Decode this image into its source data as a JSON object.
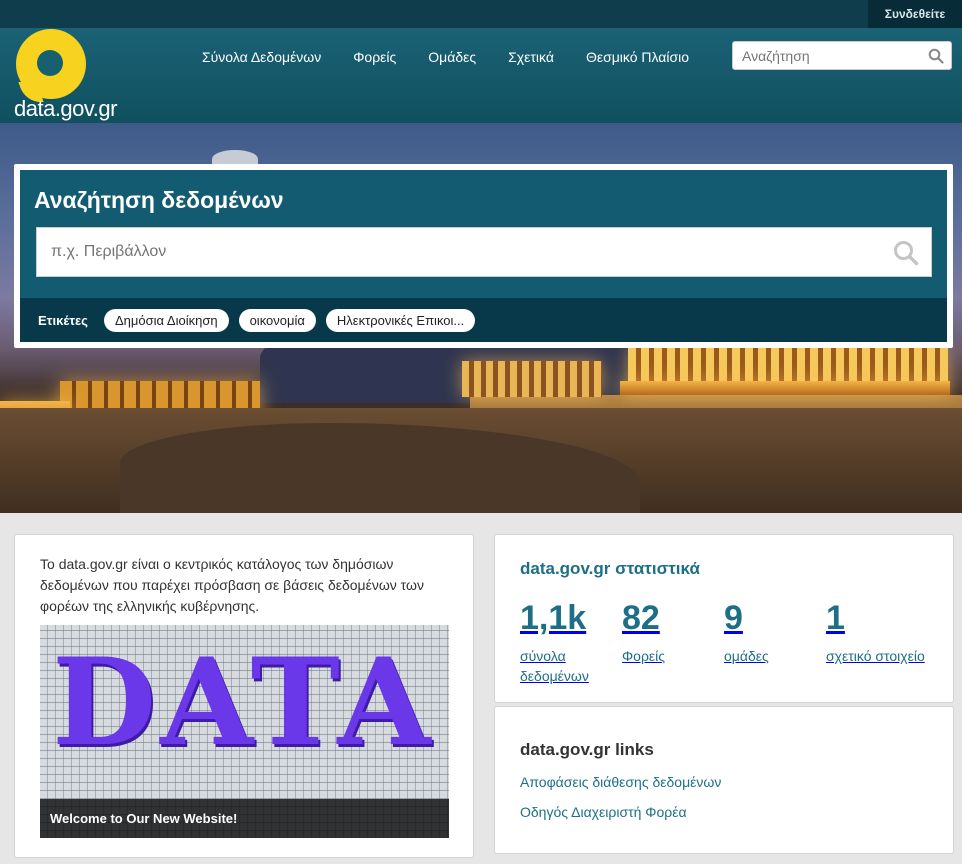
{
  "account": {
    "login_label": "Συνδεθείτε"
  },
  "logo": {
    "text": "data.gov.gr"
  },
  "nav": {
    "items": [
      {
        "label": "Σύνολα Δεδομένων"
      },
      {
        "label": "Φορείς"
      },
      {
        "label": "Ομάδες"
      },
      {
        "label": "Σχετικά"
      },
      {
        "label": "Θεσμικό Πλαίσιο"
      }
    ]
  },
  "header_search": {
    "placeholder": "Αναζήτηση"
  },
  "hero": {
    "search_title": "Αναζήτηση δεδομένων",
    "search_placeholder": "π.χ. Περιβάλλον",
    "tags_label": "Ετικέτες",
    "tags": [
      {
        "label": "Δημόσια Διοίκηση"
      },
      {
        "label": "οικονομία"
      },
      {
        "label": "Ηλεκτρονικές Επικοι..."
      }
    ]
  },
  "about": {
    "text": "Το data.gov.gr είναι ο κεντρικός κατάλογος των δημόσιων δεδομένων που παρέχει πρόσβαση σε βάσεις δεδομένων των φορέων της ελληνικής κυβέρνησης.",
    "image_word": "DATA",
    "caption": "Welcome to Our New Website!"
  },
  "stats": {
    "title": "data.gov.gr στατιστικά",
    "items": [
      {
        "value": "1,1k",
        "label": "σύνολα δεδομένων"
      },
      {
        "value": "82",
        "label": "Φορείς"
      },
      {
        "value": "9",
        "label": "ομάδες"
      },
      {
        "value": "1",
        "label": "σχετικό στοιχείο"
      }
    ]
  },
  "links": {
    "title": "data.gov.gr links",
    "items": [
      {
        "label": "Αποφάσεις διάθεσης δεδομένων"
      },
      {
        "label": "Οδηγός Διαχειριστή Φορέα"
      }
    ]
  },
  "colors": {
    "primary": "#125b70",
    "accent": "#1d6f88",
    "logo_yellow": "#f7d320",
    "tags_bar": "#08394a"
  },
  "icons": [
    "search-icon",
    "logo-icon"
  ]
}
